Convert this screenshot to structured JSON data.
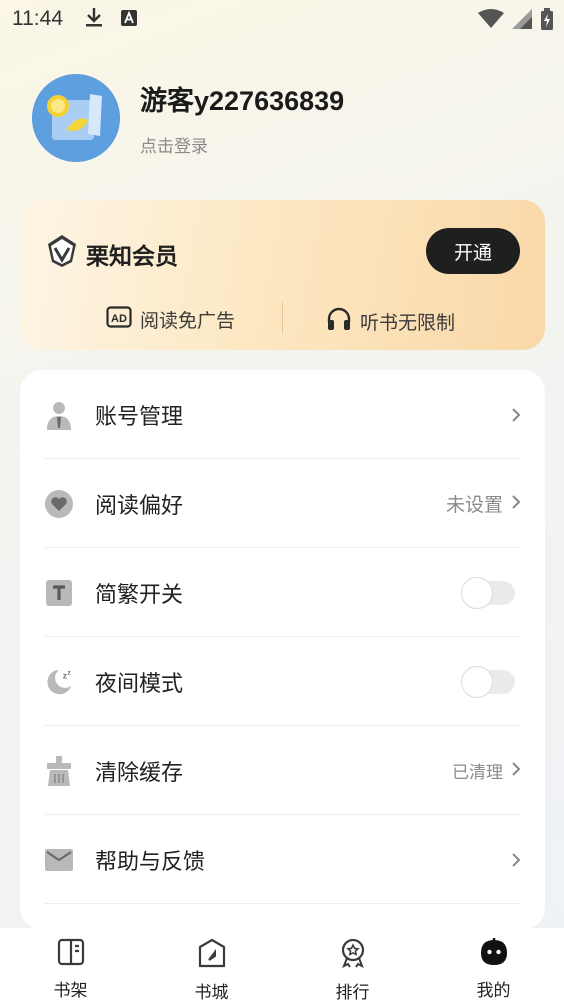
{
  "status_bar": {
    "time": "11:44"
  },
  "profile": {
    "username": "游客y227636839",
    "login_hint": "点击登录"
  },
  "vip": {
    "title": "栗知会员",
    "open_button": "开通",
    "features": [
      {
        "label": "阅读免广告",
        "icon": "ad-icon"
      },
      {
        "label": "听书无限制",
        "icon": "headphones-icon"
      }
    ]
  },
  "menu": {
    "items": [
      {
        "label": "账号管理",
        "icon": "person-icon"
      },
      {
        "label": "阅读偏好",
        "icon": "heart-icon",
        "value": "未设置"
      },
      {
        "label": "简繁开关",
        "icon": "text-t-icon",
        "toggle": false
      },
      {
        "label": "夜间模式",
        "icon": "moon-icon",
        "toggle": false
      },
      {
        "label": "清除缓存",
        "icon": "broom-icon",
        "value": "已清理"
      },
      {
        "label": "帮助与反馈",
        "icon": "mail-icon"
      }
    ]
  },
  "tabs": [
    {
      "label": "书架",
      "icon": "bookshelf-icon"
    },
    {
      "label": "书城",
      "icon": "bookstore-icon"
    },
    {
      "label": "排行",
      "icon": "ranking-icon"
    },
    {
      "label": "我的",
      "icon": "mine-icon",
      "active": true
    }
  ]
}
